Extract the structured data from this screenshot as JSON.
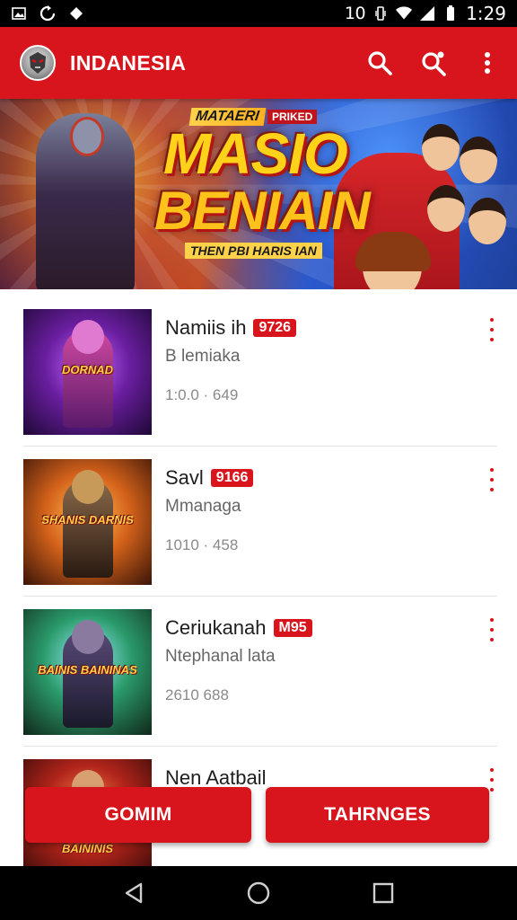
{
  "status_bar": {
    "left_icons": [
      "image-icon",
      "sync-icon",
      "diamond-icon"
    ],
    "battery_text": "10",
    "time": "1:29"
  },
  "app_bar": {
    "title": "INDANESIA",
    "avatar_icon": "warrior-avatar-icon",
    "actions": [
      "search-icon",
      "search-settings-icon",
      "more-vert-icon"
    ],
    "color": "#d8141c"
  },
  "banner": {
    "kicker": "MATAERI",
    "badge": "PRIKED",
    "title_line1": "MASIO",
    "title_line2": "BENIAIN",
    "subtitle": "THEN PBI HARIS IAN"
  },
  "list": {
    "items": [
      {
        "title": "Namiis ih",
        "badge": "9726",
        "subtitle": "B lemiaka",
        "meta": "1:0.0 · 649",
        "thumb_label": "DORNAD"
      },
      {
        "title": "Savl",
        "badge": "9166",
        "subtitle": "Mmanaga",
        "meta": "1010 · 458",
        "thumb_label": "SHANIS DARNIS"
      },
      {
        "title": "Ceriukanah",
        "badge": "M95",
        "subtitle": "Ntephanal lata",
        "meta": "2610 688",
        "thumb_label": "BAINIS BAININAS"
      },
      {
        "title": "Nen Aatbail",
        "badge": "",
        "subtitle": "",
        "meta": "",
        "thumb_label": "BAININIS"
      }
    ]
  },
  "buttons": {
    "left_label": "GOMIM",
    "right_label": "TAHRNGES"
  },
  "nav_bar": {
    "items": [
      "back-icon",
      "home-icon",
      "recents-icon"
    ]
  }
}
